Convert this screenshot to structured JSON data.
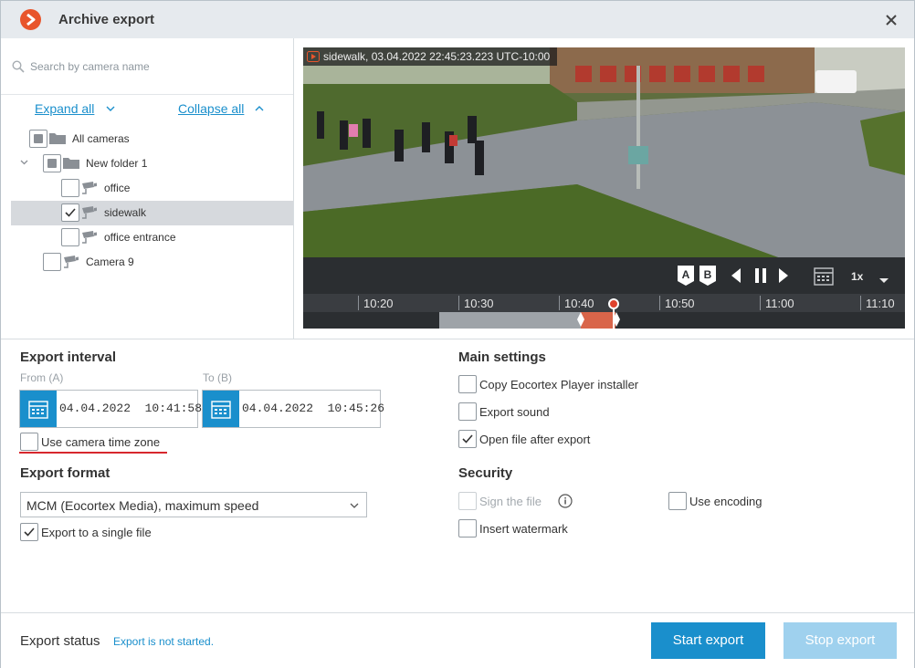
{
  "window": {
    "title": "Archive export",
    "logo_icon": "chevron-right-icon",
    "close_icon": "close-icon"
  },
  "tree": {
    "search_placeholder": "Search by camera name",
    "expand_all": "Expand all",
    "collapse_all": "Collapse all",
    "items": [
      {
        "label": "All cameras",
        "state": "partial",
        "icon": "folder-icon"
      },
      {
        "label": "New folder 1",
        "state": "partial",
        "icon": "folder-icon"
      },
      {
        "label": "office",
        "state": "unchecked",
        "icon": "camera-icon"
      },
      {
        "label": "sidewalk",
        "state": "checked",
        "icon": "camera-icon",
        "selected": true
      },
      {
        "label": "office entrance",
        "state": "unchecked",
        "icon": "camera-icon"
      },
      {
        "label": "Camera 9",
        "state": "unchecked",
        "icon": "camera-icon"
      }
    ]
  },
  "preview": {
    "overlay": "sidewalk, 03.04.2022 22:45:23.223 UTC-10:00",
    "speed": "1x",
    "marker_a": "A",
    "marker_b": "B",
    "timeline_labels": [
      "10:20",
      "10:30",
      "10:40",
      "10:50",
      "11:00",
      "11:10"
    ]
  },
  "interval": {
    "title": "Export interval",
    "from_label": "From (A)",
    "to_label": "To (B)",
    "from_value": "04.04.2022  10:41:58",
    "to_value": "04.04.2022  10:45:26",
    "camera_tz_label": "Use camera time zone"
  },
  "format": {
    "title": "Export format",
    "selected": "MCM (Eocortex Media), maximum speed",
    "single_file_label": "Export to a single file"
  },
  "main_settings": {
    "title": "Main settings",
    "copy_player": "Copy Eocortex Player installer",
    "export_sound": "Export sound",
    "open_after": "Open file after export"
  },
  "security": {
    "title": "Security",
    "sign_file": "Sign the file",
    "use_encoding": "Use encoding",
    "insert_watermark": "Insert watermark"
  },
  "footer": {
    "status_label": "Export status",
    "status_value": "Export is not started.",
    "start_button": "Start export",
    "stop_button": "Stop export"
  },
  "colors": {
    "accent": "#1a8fcc",
    "brand": "#e8552c",
    "alert": "#d7272d",
    "disabled_button": "#9fd1ee"
  }
}
